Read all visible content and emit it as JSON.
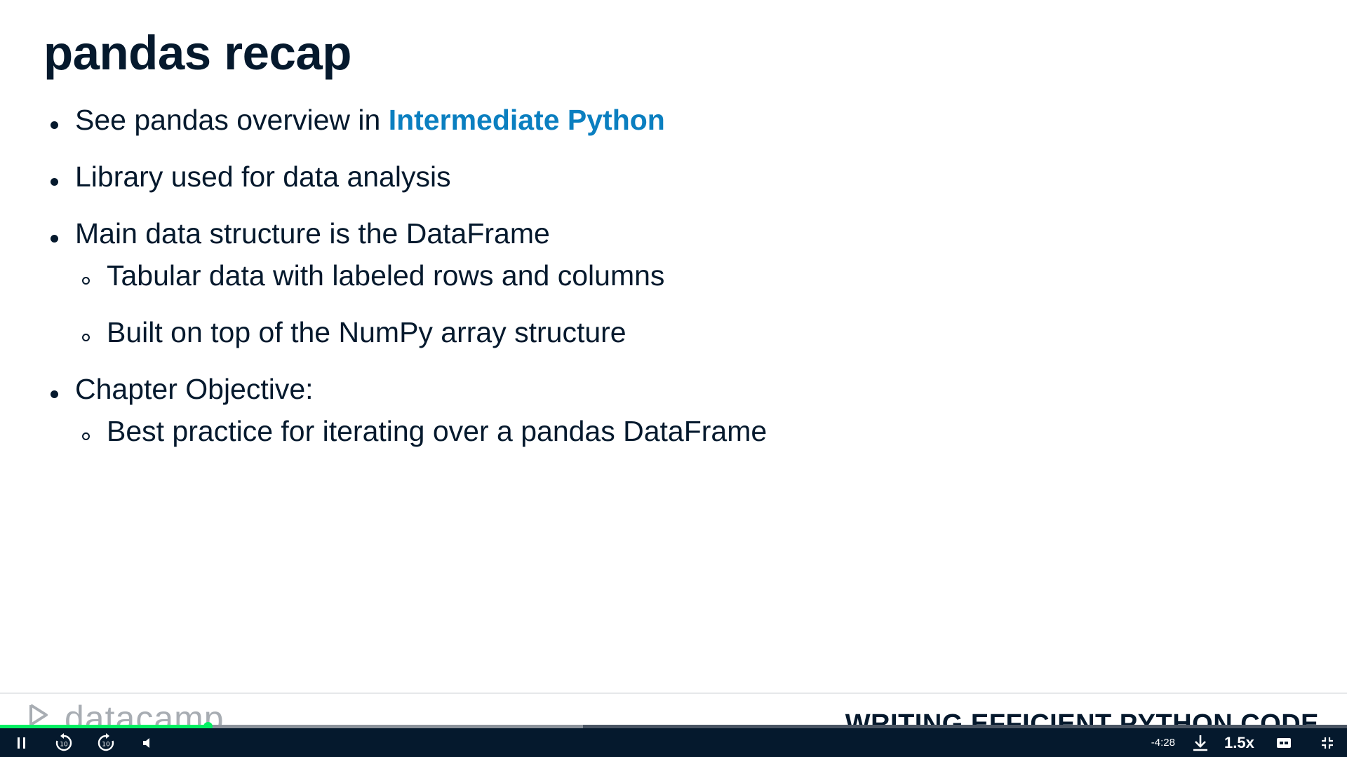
{
  "slide": {
    "title": "pandas recap",
    "bullets": [
      {
        "text_prefix": "See pandas overview in ",
        "link_text": "Intermediate Python"
      },
      {
        "text": "Library used for data analysis"
      },
      {
        "text": "Main data structure is the DataFrame"
      },
      {
        "text": "Tabular data with labeled rows and columns"
      },
      {
        "text": "Built on top of the NumPy array structure"
      },
      {
        "text": "Chapter Objective:"
      },
      {
        "text": "Best practice for iterating over a pandas DataFrame"
      }
    ],
    "link_color": "#0b7fc0",
    "text_color": "#05192d"
  },
  "footer": {
    "logo_text": "datacamp",
    "course_name": "WRITING EFFICIENT PYTHON CODE"
  },
  "player": {
    "time_remaining": "-4:28",
    "speed": "1.5x",
    "played_fraction": 0.154,
    "buffered_fraction": 0.433,
    "progress_color": "#03ef62",
    "controls": [
      "pause-icon",
      "rewind-10-icon",
      "forward-10-icon",
      "volume-icon",
      "download-icon",
      "captions-icon",
      "exit-fullscreen-icon"
    ]
  }
}
